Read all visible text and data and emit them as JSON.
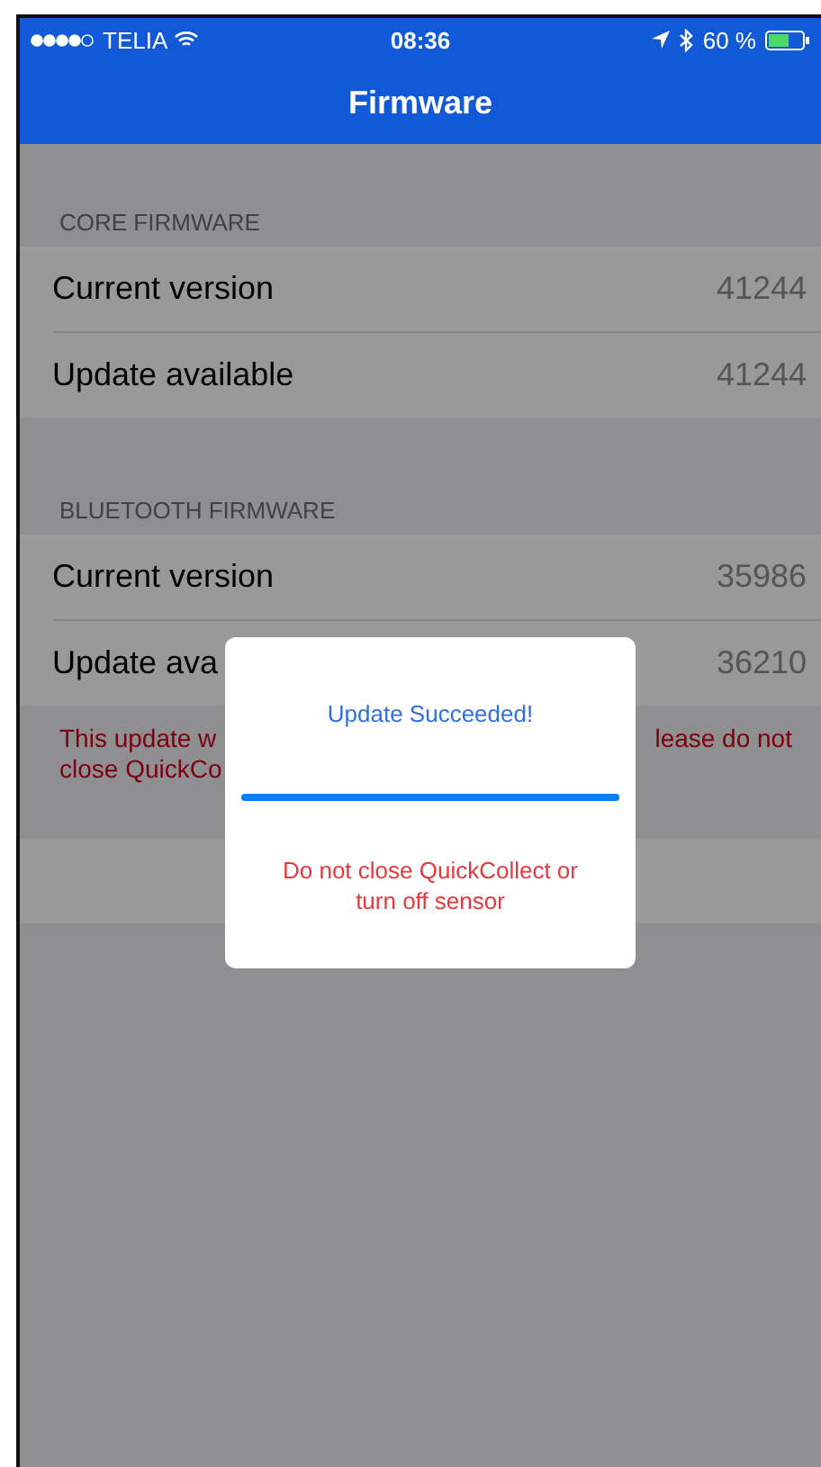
{
  "status_bar": {
    "carrier": "TELIA",
    "time": "08:36",
    "battery": "60 %"
  },
  "nav_bar": {
    "title": "Firmware"
  },
  "sections": [
    {
      "header": "CORE FIRMWARE",
      "rows": [
        {
          "label": "Current version",
          "value": "41244"
        },
        {
          "label": "Update available",
          "value": "41244"
        }
      ]
    },
    {
      "header": "BLUETOOTH FIRMWARE",
      "rows": [
        {
          "label": "Current version",
          "value": "35986"
        },
        {
          "label": "Update ava",
          "value": "36210"
        }
      ],
      "warning": {
        "left": "This update w\nclose QuickCo",
        "right": "lease do not"
      }
    }
  ],
  "dialog": {
    "title": "Update Succeeded!",
    "progress": {
      "level": 1
    },
    "message": "Do not close QuickCollect or turn off sensor"
  }
}
